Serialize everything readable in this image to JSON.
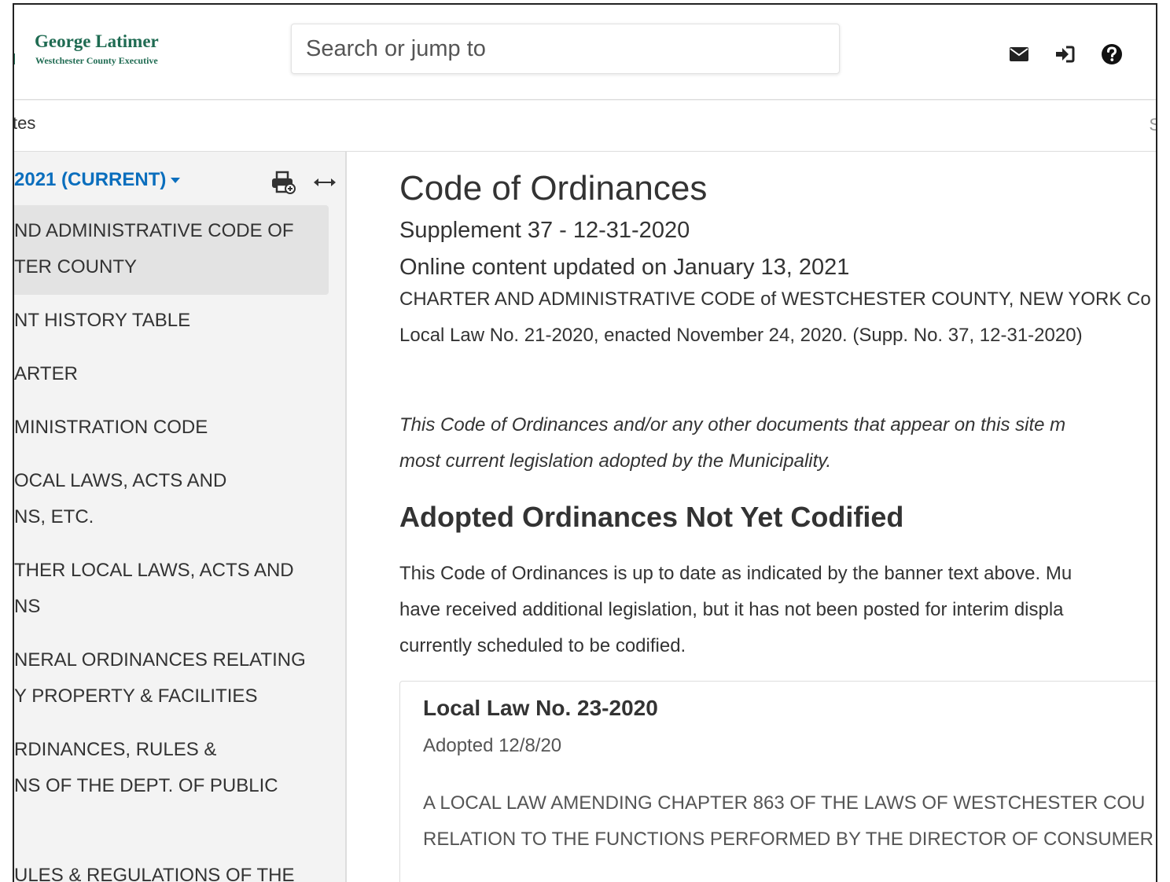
{
  "header": {
    "brand_name": "George Latimer",
    "brand_subtitle": "Westchester County Executive",
    "search_placeholder": "Search or jump to",
    "icons": [
      "envelope-icon",
      "sign-in-icon",
      "help-icon"
    ]
  },
  "subbar": {
    "text": "tes"
  },
  "sidebar": {
    "version_label": "2021 (CURRENT)",
    "tools": [
      "print-icon",
      "expand-width-icon"
    ],
    "items": [
      {
        "line1": "ND ADMINISTRATIVE CODE OF",
        "line2": "TER COUNTY",
        "active": true
      },
      {
        "line1": "NT HISTORY TABLE",
        "line2": ""
      },
      {
        "line1": "ARTER",
        "line2": ""
      },
      {
        "line1": "MINISTRATION CODE",
        "line2": ""
      },
      {
        "line1": "OCAL LAWS, ACTS AND",
        "line2": "NS, ETC."
      },
      {
        "line1": "THER LOCAL LAWS, ACTS AND",
        "line2": "NS"
      },
      {
        "line1": "NERAL ORDINANCES RELATING",
        "line2": "Y PROPERTY & FACILITIES"
      },
      {
        "line1": "RDINANCES, RULES &",
        "line2": "NS OF THE DEPT. OF PUBLIC"
      },
      {
        "line1": "",
        "line2": ""
      },
      {
        "line1": "ULES & REGULATIONS OF THE",
        "line2": ""
      }
    ]
  },
  "main": {
    "title": "Code of Ordinances",
    "supplement": "Supplement 37 - 12-31-2020",
    "updated": "Online content updated on January 13, 2021",
    "charter_line": "CHARTER AND ADMINISTRATIVE CODE of WESTCHESTER COUNTY, NEW YORK Co",
    "local_law_line": "Local Law No. 21-2020, enacted November 24, 2020. (Supp. No. 37, 12-31-2020)",
    "disclaimer_line1": "This Code of Ordinances and/or any other documents that appear on this site m",
    "disclaimer_line2": "most current legislation adopted by the Municipality.",
    "section_heading": "Adopted Ordinances Not Yet Codified",
    "para_line1": "This Code of Ordinances is up to date as indicated by the banner text above. Mu",
    "para_line2": "have received additional legislation, but it has not been posted for interim displa",
    "para_line3": "currently scheduled to be codified.",
    "card": {
      "title": "Local Law No. 23-2020",
      "adopted": "Adopted 12/8/20",
      "body_line1": "A LOCAL LAW AMENDING CHAPTER 863 OF THE LAWS OF WESTCHESTER COU",
      "body_line2": "RELATION TO THE FUNCTIONS PERFORMED BY THE DIRECTOR OF CONSUMER"
    }
  },
  "colors": {
    "brand_green": "#1f6b52",
    "link_blue": "#0a6ebd",
    "sidebar_bg": "#f3f3f3",
    "active_item_bg": "#e3e3e3"
  }
}
